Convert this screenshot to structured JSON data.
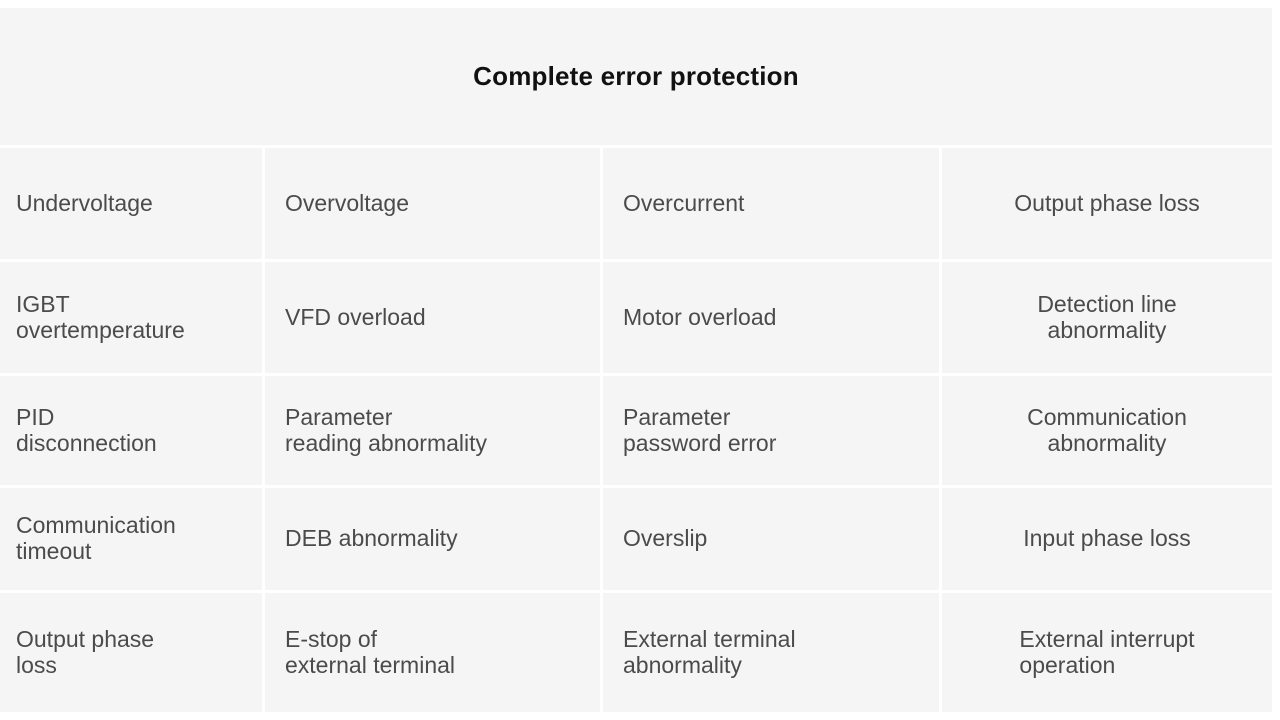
{
  "header": {
    "title": "Complete error protection"
  },
  "colors": {
    "page_background": "#ffffff",
    "panel_background": "#f5f5f5",
    "cell_background": "#f5f5f5",
    "divider": "#ffffff",
    "title_text": "#111111",
    "cell_text": "#4b4b4b"
  },
  "table": {
    "columns": 4,
    "rows": [
      {
        "cells": [
          "Undervoltage",
          "Overvoltage",
          "Overcurrent",
          "Output phase loss"
        ]
      },
      {
        "cells": [
          "IGBT\novertemperature",
          "VFD overload",
          "Motor overload",
          "Detection line\nabnormality"
        ]
      },
      {
        "cells": [
          "PID\ndisconnection",
          "Parameter\nreading abnormality",
          "Parameter\npassword error",
          "Communication\nabnormality"
        ]
      },
      {
        "cells": [
          "Communication\ntimeout",
          "DEB abnormality",
          "Overslip",
          "Input phase loss"
        ]
      },
      {
        "cells": [
          "Output phase\nloss",
          "E-stop of\nexternal terminal",
          "External terminal\nabnormality",
          "External interrupt\noperation"
        ]
      }
    ]
  }
}
